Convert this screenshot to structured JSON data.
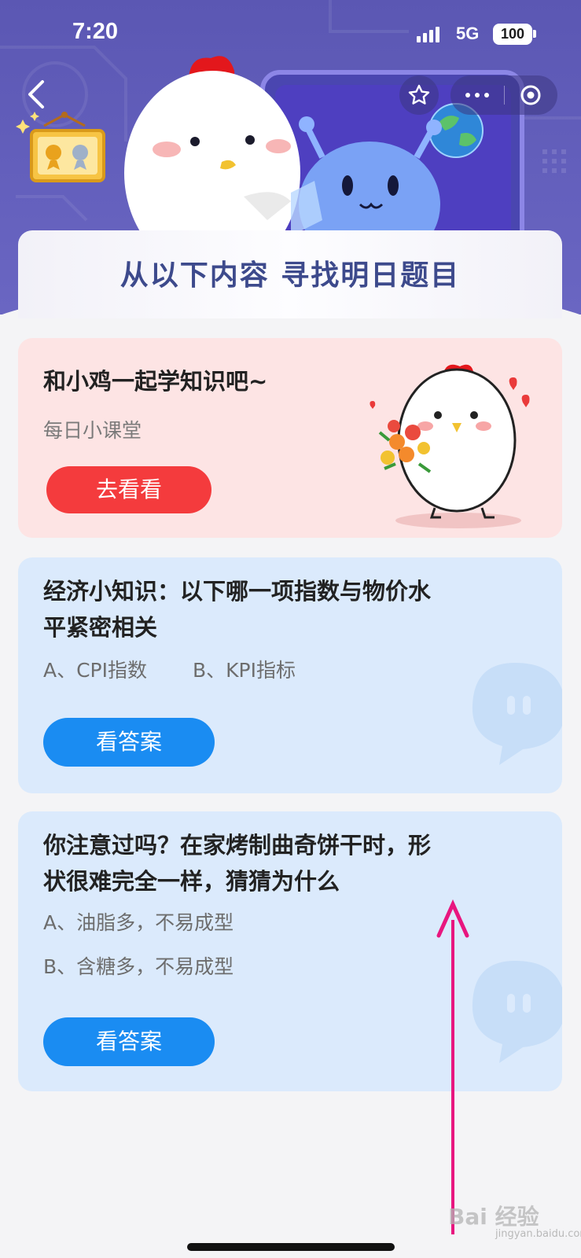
{
  "status_bar": {
    "time": "7:20",
    "network": "5G",
    "battery": "100"
  },
  "header": {
    "banner_title": "从以下内容  寻找明日题目"
  },
  "card_classroom": {
    "title": "和小鸡一起学知识吧~",
    "subtitle": "每日小课堂",
    "button_label": "去看看"
  },
  "card_quiz1": {
    "question_line1": "经济小知识：以下哪一项指数与物价水",
    "question_line2": "平紧密相关",
    "option_a": "A、CPI指数",
    "option_b": "B、KPI指标",
    "button_label": "看答案"
  },
  "card_quiz2": {
    "question_line1": "你注意过吗？在家烤制曲奇饼干时，形",
    "question_line2": "状很难完全一样，猜猜为什么",
    "option_a": "A、油脂多，不易成型",
    "option_b": "B、含糖多，不易成型",
    "button_label": "看答案"
  },
  "watermark": {
    "brand": "Bai 经验",
    "sub": "jingyan.baidu.com"
  },
  "colors": {
    "hero": "#5b57b3",
    "pink_card": "#fde4e4",
    "blue_card": "#dbeafc",
    "red_button": "#f43b3d",
    "blue_button": "#1a8cf2",
    "arrow": "#e8167f"
  },
  "icons": [
    "back-arrow-icon",
    "star-icon",
    "more-dots-icon",
    "target-icon",
    "medal-plaque-icon",
    "chick-mascot",
    "alien-mascot",
    "earth-icon",
    "chat-bubble-icon",
    "annotation-arrow"
  ]
}
